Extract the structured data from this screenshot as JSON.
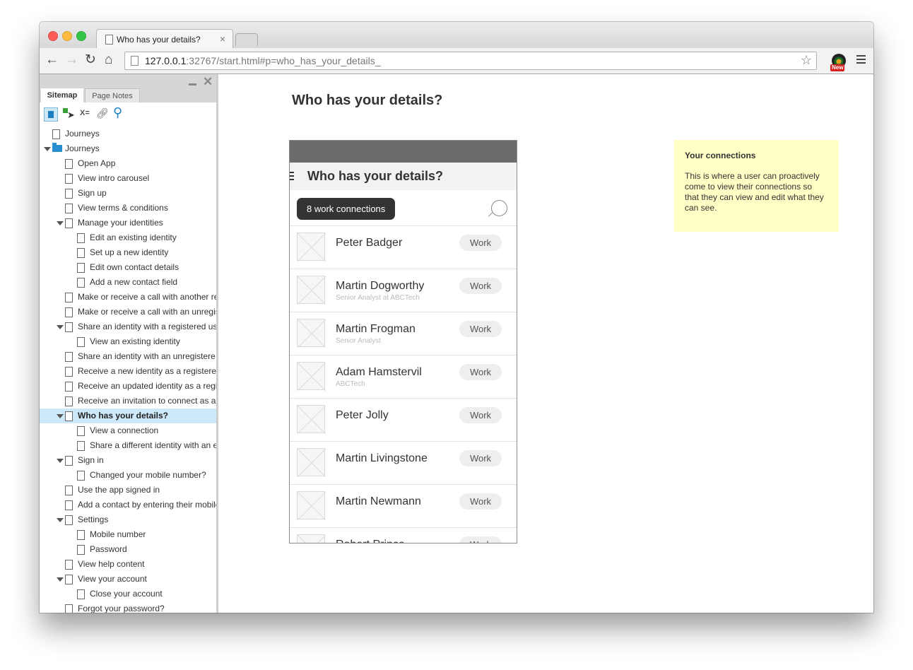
{
  "browser": {
    "tab_title": "Who has your details?",
    "tab_close": "×",
    "url_host": "127.0.0.1",
    "url_rest": ":32767/start.html#p=who_has_your_details_",
    "extension_badge": "New"
  },
  "sidebar": {
    "tabs": {
      "sitemap": "Sitemap",
      "page_notes": "Page Notes"
    },
    "tool_vars_label": "X=",
    "close_glyph": "✕",
    "items": [
      {
        "label": "Journeys",
        "level": 0,
        "kind": "page",
        "arrow": false
      },
      {
        "label": "Journeys",
        "level": 0,
        "kind": "folder",
        "arrow": true
      },
      {
        "label": "Open App",
        "level": 1,
        "kind": "page",
        "arrow": false
      },
      {
        "label": "View intro carousel",
        "level": 1,
        "kind": "page",
        "arrow": false
      },
      {
        "label": "Sign up",
        "level": 1,
        "kind": "page",
        "arrow": false
      },
      {
        "label": "View terms & conditions",
        "level": 1,
        "kind": "page",
        "arrow": false
      },
      {
        "label": "Manage your identities",
        "level": 1,
        "kind": "page",
        "arrow": true
      },
      {
        "label": "Edit an existing identity",
        "level": 2,
        "kind": "page",
        "arrow": false
      },
      {
        "label": "Set up a new identity",
        "level": 2,
        "kind": "page",
        "arrow": false
      },
      {
        "label": "Edit own contact details",
        "level": 2,
        "kind": "page",
        "arrow": false
      },
      {
        "label": "Add a new contact field",
        "level": 2,
        "kind": "page",
        "arrow": false
      },
      {
        "label": "Make or receive a call with another re",
        "level": 1,
        "kind": "page",
        "arrow": false
      },
      {
        "label": "Make or receive a call with an unregis",
        "level": 1,
        "kind": "page",
        "arrow": false
      },
      {
        "label": "Share an identity with a registered us",
        "level": 1,
        "kind": "page",
        "arrow": true
      },
      {
        "label": "View an existing identity",
        "level": 2,
        "kind": "page",
        "arrow": false
      },
      {
        "label": "Share an identity with an unregistere",
        "level": 1,
        "kind": "page",
        "arrow": false
      },
      {
        "label": "Receive a new identity as a registere",
        "level": 1,
        "kind": "page",
        "arrow": false
      },
      {
        "label": "Receive an updated identity as a regi",
        "level": 1,
        "kind": "page",
        "arrow": false
      },
      {
        "label": "Receive an invitation to connect as a",
        "level": 1,
        "kind": "page",
        "arrow": false
      },
      {
        "label": "Who has your details?",
        "level": 1,
        "kind": "page",
        "arrow": true,
        "selected": true
      },
      {
        "label": "View a connection",
        "level": 2,
        "kind": "page",
        "arrow": false
      },
      {
        "label": "Share a different identity with an e",
        "level": 2,
        "kind": "page",
        "arrow": false
      },
      {
        "label": "Sign in",
        "level": 1,
        "kind": "page",
        "arrow": true
      },
      {
        "label": "Changed your mobile number?",
        "level": 2,
        "kind": "page",
        "arrow": false
      },
      {
        "label": "Use the app signed in",
        "level": 1,
        "kind": "page",
        "arrow": false
      },
      {
        "label": "Add a contact by entering their mobile",
        "level": 1,
        "kind": "page",
        "arrow": false
      },
      {
        "label": "Settings",
        "level": 1,
        "kind": "page",
        "arrow": true
      },
      {
        "label": "Mobile number",
        "level": 2,
        "kind": "page",
        "arrow": false
      },
      {
        "label": "Password",
        "level": 2,
        "kind": "page",
        "arrow": false
      },
      {
        "label": "View help content",
        "level": 1,
        "kind": "page",
        "arrow": false
      },
      {
        "label": "View your account",
        "level": 1,
        "kind": "page",
        "arrow": true
      },
      {
        "label": "Close your account",
        "level": 2,
        "kind": "page",
        "arrow": false
      },
      {
        "label": "Forgot your password?",
        "level": 1,
        "kind": "page",
        "arrow": false
      }
    ]
  },
  "main": {
    "page_title": "Who has your details?",
    "phone": {
      "title": "Who has your details?",
      "filter_label": "8 work connections",
      "contacts": [
        {
          "name": "Peter Badger",
          "subtitle": "",
          "badge": "Work"
        },
        {
          "name": "Martin Dogworthy",
          "subtitle": "Senior Analyst at ABCTech",
          "badge": "Work"
        },
        {
          "name": "Martin Frogman",
          "subtitle": "Senior Analyst",
          "badge": "Work"
        },
        {
          "name": "Adam Hamstervil",
          "subtitle": "ABCTech",
          "badge": "Work"
        },
        {
          "name": "Peter Jolly",
          "subtitle": "",
          "badge": "Work"
        },
        {
          "name": "Martin Livingstone",
          "subtitle": "",
          "badge": "Work"
        },
        {
          "name": "Martin Newmann",
          "subtitle": "",
          "badge": "Work"
        },
        {
          "name": "Robert Prince",
          "subtitle": "",
          "badge": "Work"
        }
      ]
    },
    "note": {
      "title": "Your connections",
      "body": "This is where a user can proactively come to view their connections so that they can view and edit what they can see."
    }
  }
}
